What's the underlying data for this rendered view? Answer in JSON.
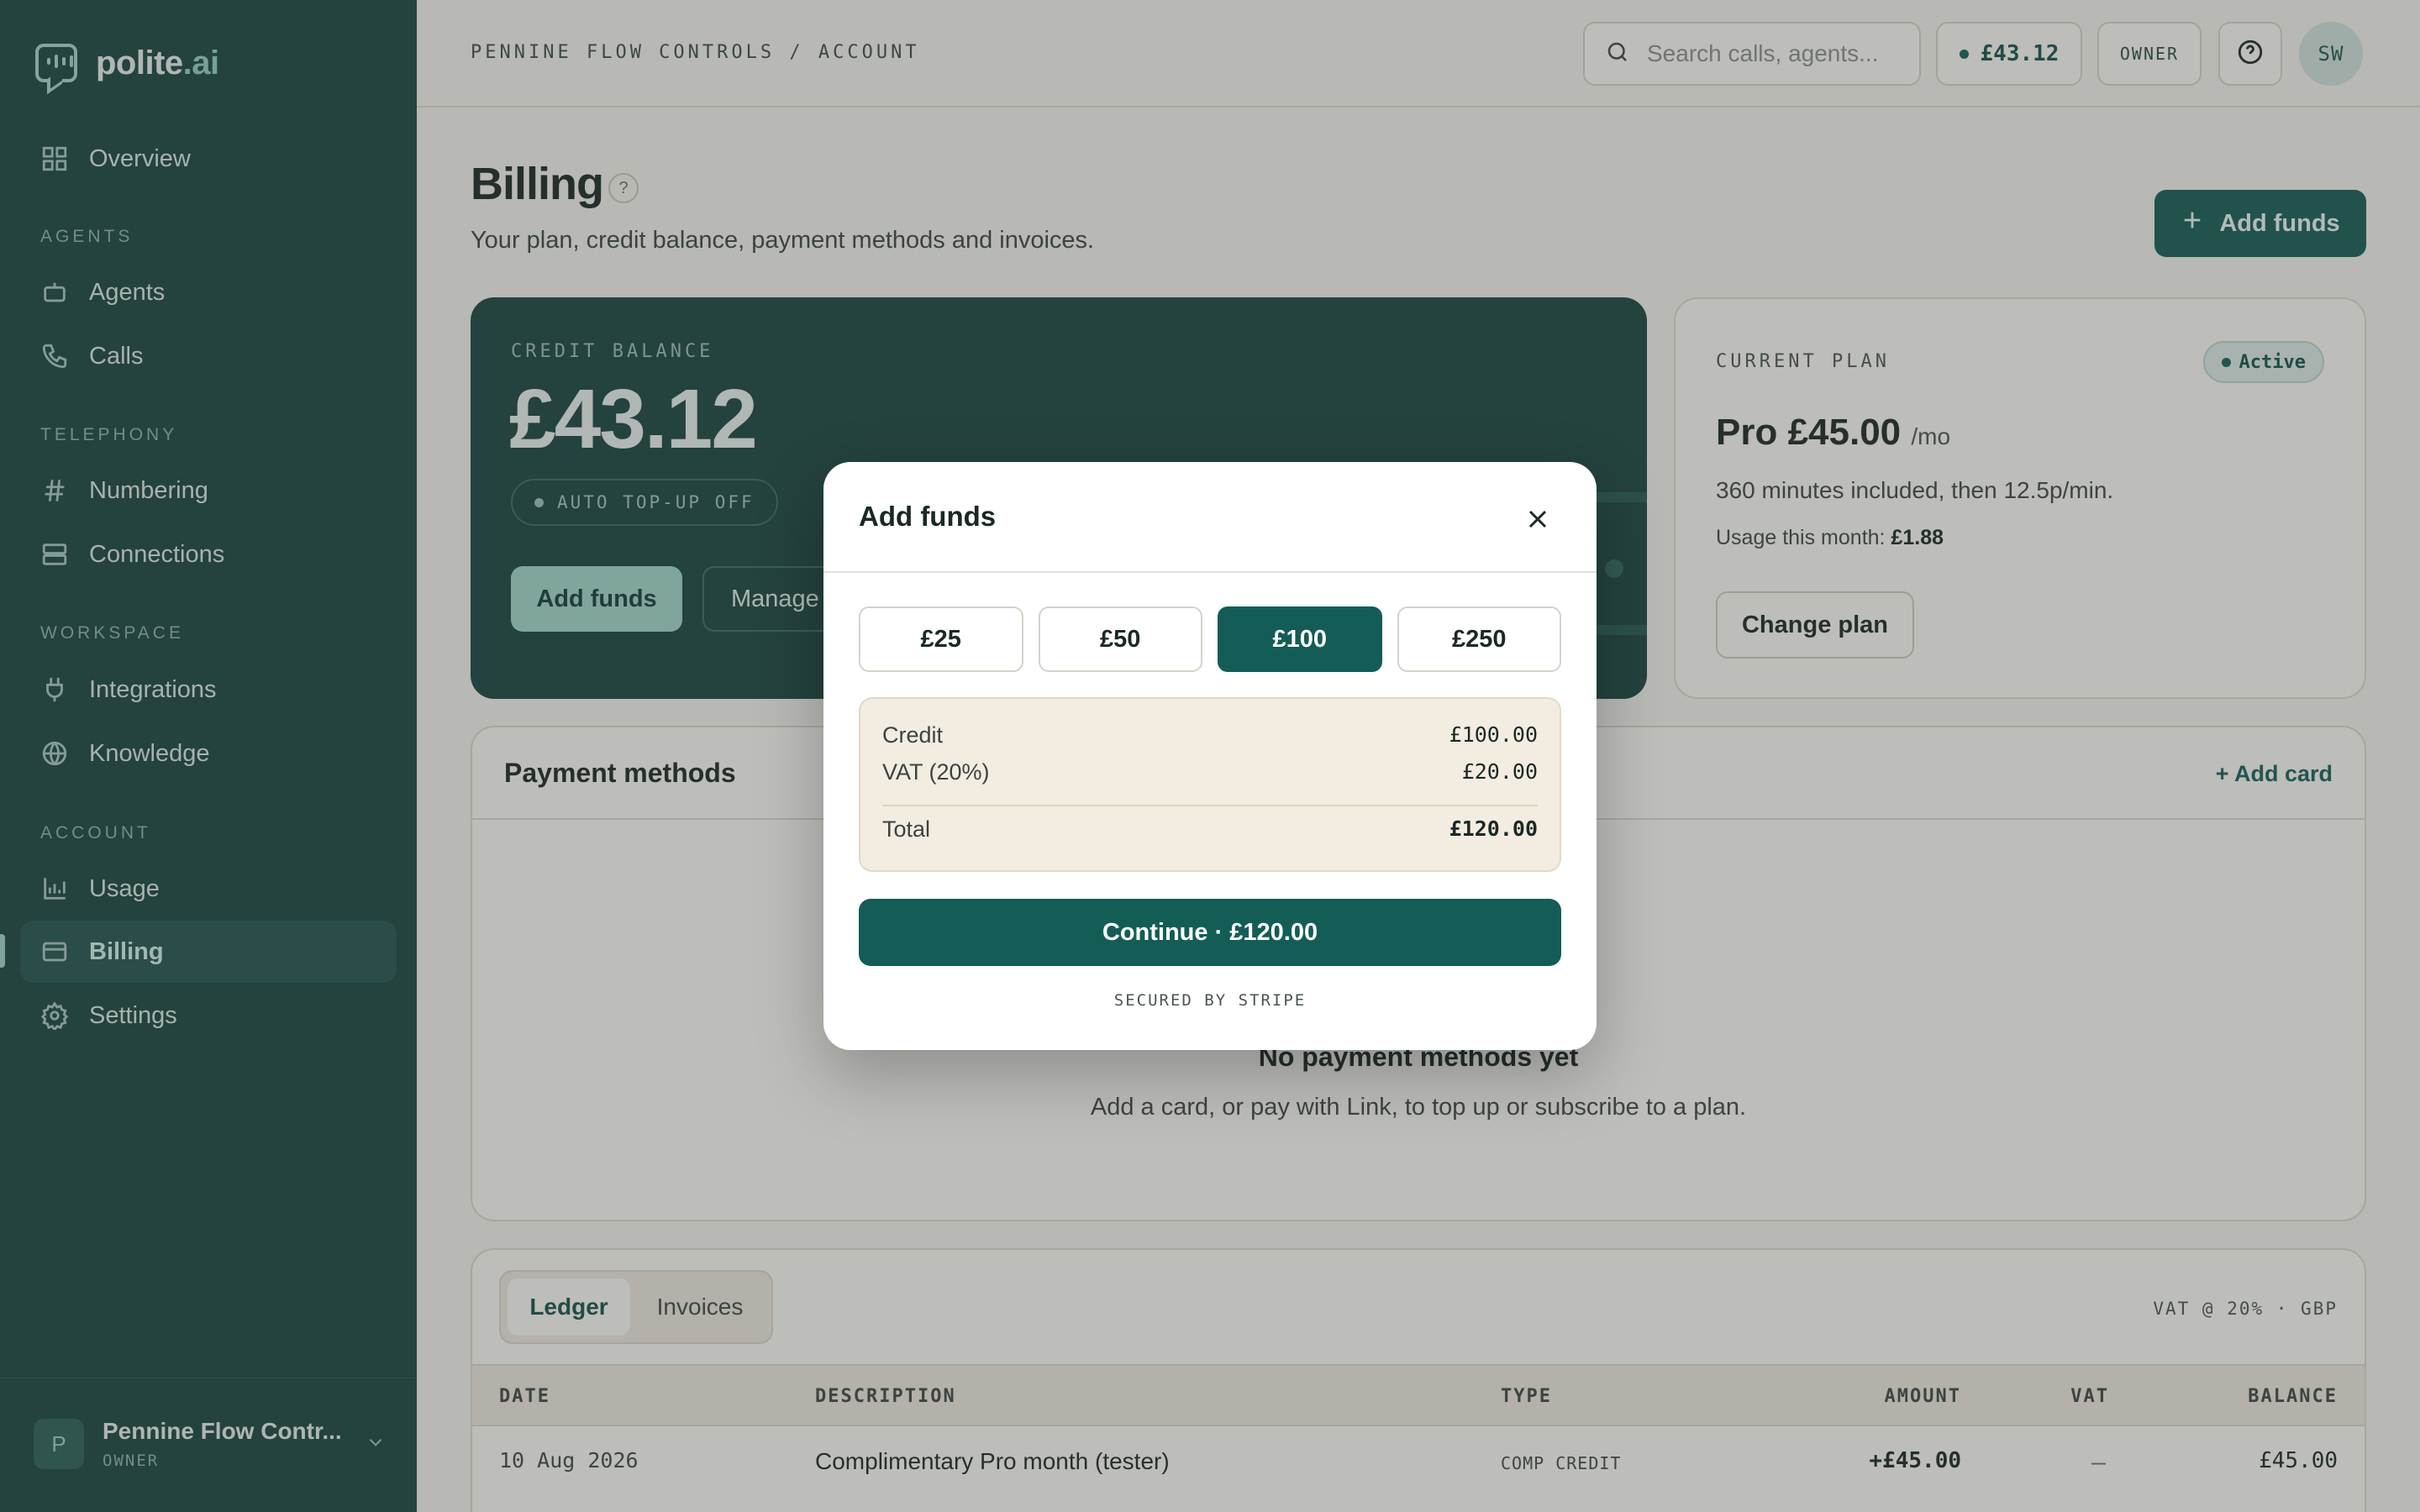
{
  "brand": {
    "name_main": "polite",
    "name_accent": ".ai",
    "icon": "chat-bubble-waveform-icon"
  },
  "sidebar": {
    "overview": "Overview",
    "sections": {
      "agents": "AGENTS",
      "telephony": "TELEPHONY",
      "workspace": "WORKSPACE",
      "account": "ACCOUNT"
    },
    "items": {
      "agents": "Agents",
      "calls": "Calls",
      "numbering": "Numbering",
      "connections": "Connections",
      "integrations": "Integrations",
      "knowledge": "Knowledge",
      "usage": "Usage",
      "billing": "Billing",
      "settings": "Settings"
    },
    "active": "billing",
    "org": {
      "initial": "P",
      "name": "Pennine Flow Contr...",
      "role": "OWNER"
    }
  },
  "topbar": {
    "breadcrumb": "PENNINE FLOW CONTROLS / ACCOUNT",
    "search_placeholder": "Search calls, agents...",
    "balance": "£43.12",
    "role": "OWNER",
    "user_initials": "SW"
  },
  "page": {
    "title": "Billing",
    "help": "?",
    "subtitle": "Your plan, credit balance, payment methods and invoices.",
    "add_funds": "Add funds"
  },
  "credit_card": {
    "label": "CREDIT BALANCE",
    "amount": "£43.12",
    "auto_topup": "AUTO TOP-UP OFF",
    "add_funds": "Add funds",
    "manage": "Manage"
  },
  "plan_card": {
    "label": "CURRENT PLAN",
    "status": "Active",
    "name": "Pro £45.00",
    "period": "/mo",
    "description": "360 minutes included, then 12.5p/min.",
    "usage_label": "Usage this month:",
    "usage_value": "£1.88",
    "change_plan": "Change plan"
  },
  "payment_methods": {
    "title": "Payment methods",
    "add_card": "+ Add card",
    "empty_title": "No payment methods yet",
    "empty_desc": "Add a card, or pay with Link, to top up or subscribe to a plan."
  },
  "ledger": {
    "tabs": [
      "Ledger",
      "Invoices"
    ],
    "active_tab": "Ledger",
    "meta": "VAT @ 20% · GBP",
    "columns": [
      "DATE",
      "DESCRIPTION",
      "TYPE",
      "AMOUNT",
      "VAT",
      "BALANCE"
    ],
    "rows": [
      {
        "date": "10 Aug 2026",
        "description": "Complimentary Pro month (tester)",
        "type": "COMP CREDIT",
        "amount": "+£45.00",
        "vat": "—",
        "balance": "£45.00"
      }
    ]
  },
  "modal": {
    "title": "Add funds",
    "amounts": [
      "£25",
      "£50",
      "£100",
      "£250"
    ],
    "selected_amount": "£100",
    "summary": {
      "credit_label": "Credit",
      "credit_value": "£100.00",
      "vat_label": "VAT (20%)",
      "vat_value": "£20.00",
      "total_label": "Total",
      "total_value": "£120.00"
    },
    "continue": "Continue · £120.00",
    "secured": "SECURED BY STRIPE"
  },
  "colors": {
    "sidebar_bg": "#1a4540",
    "accent": "#135d56",
    "accent_light": "#9fd6cb",
    "page_bg": "#f4f2ee"
  }
}
